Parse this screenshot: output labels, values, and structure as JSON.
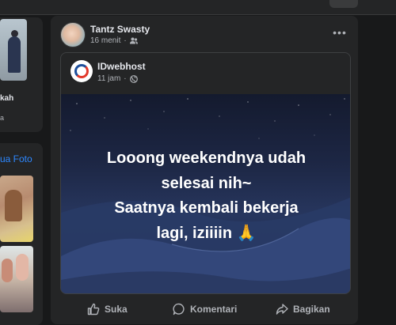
{
  "left": {
    "card1_line1": "kah",
    "card1_line2": "a",
    "link": "ua Foto"
  },
  "post": {
    "author": "Tantz Swasty",
    "time": "16 menit",
    "audience_icon": "friends-icon",
    "more_icon": "more-options-icon",
    "shared": {
      "page_name": "IDwebhost",
      "time": "11 jam",
      "audience_icon": "globe-icon",
      "banner_lines": [
        "Looong weekendnya udah",
        "selesai nih~",
        "Saatnya kembali bekerja",
        "lagi, iziiiin 🙏"
      ]
    },
    "actions": {
      "like": "Suka",
      "comment": "Komentari",
      "share": "Bagikan"
    }
  },
  "colors": {
    "background": "#18191a",
    "card": "#242526",
    "text_primary": "#e4e6eb",
    "text_secondary": "#b0b3b8",
    "link": "#2d88ff"
  }
}
